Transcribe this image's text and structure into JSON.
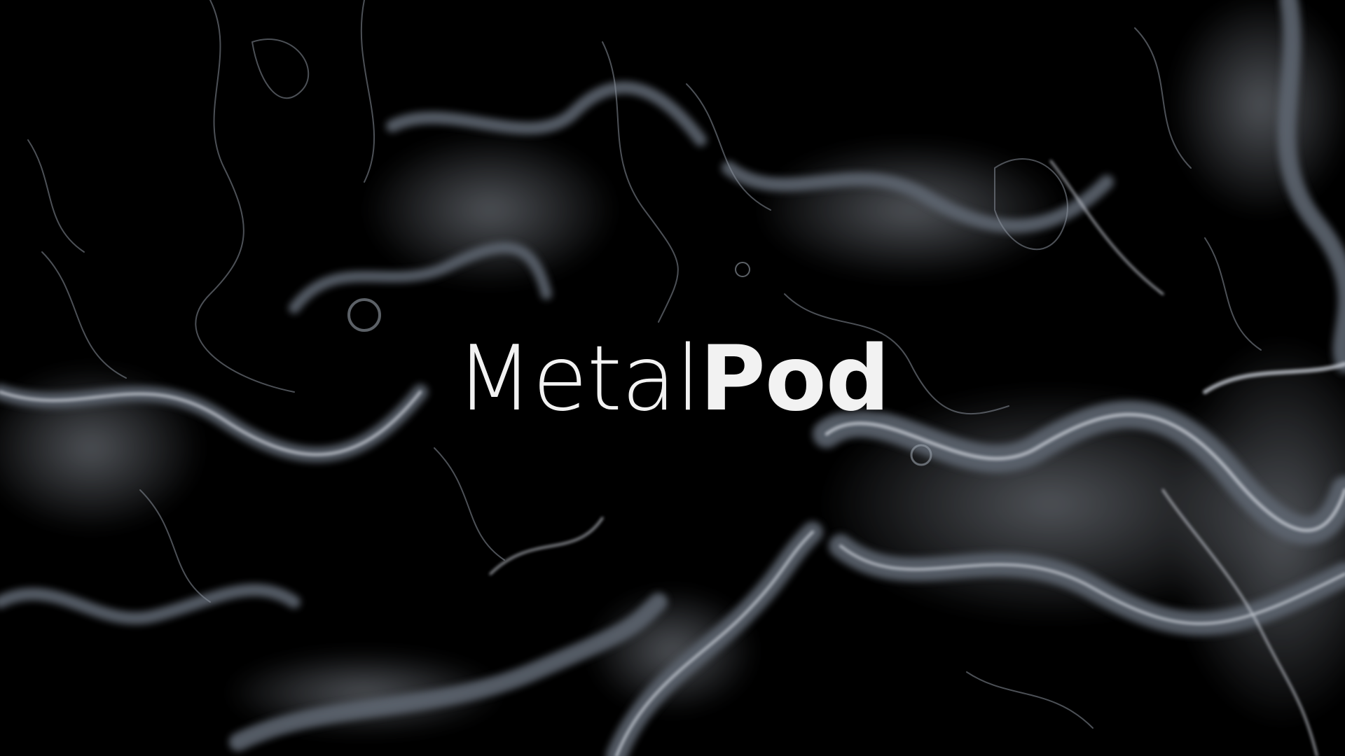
{
  "hero": {
    "logo_light": "Metal",
    "logo_bold": "Pod",
    "background": "liquid-metal-flow",
    "colors": {
      "background": "#000000",
      "metal_light": "#c9ced6",
      "metal_mid": "#6b7380",
      "text": "#f2f2f2"
    }
  }
}
